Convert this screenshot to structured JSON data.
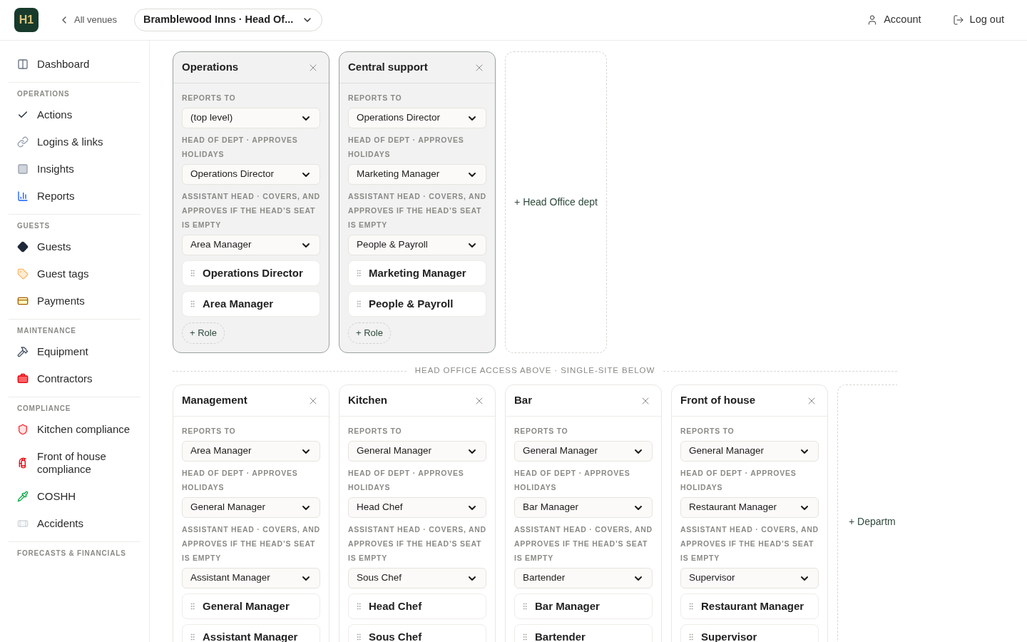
{
  "header": {
    "logo": "H1",
    "back_link": "All venues",
    "venue": "Bramblewood Inns · Head Of...",
    "account": "Account",
    "logout": "Log out"
  },
  "sidebar": {
    "top_items": [
      {
        "label": "Dashboard"
      }
    ],
    "sections": [
      {
        "title": "OPERATIONS",
        "items": [
          {
            "label": "Actions"
          },
          {
            "label": "Logins & links"
          },
          {
            "label": "Insights"
          },
          {
            "label": "Reports"
          }
        ]
      },
      {
        "title": "GUESTS",
        "items": [
          {
            "label": "Guests"
          },
          {
            "label": "Guest tags"
          },
          {
            "label": "Payments"
          }
        ]
      },
      {
        "title": "MAINTENANCE",
        "items": [
          {
            "label": "Equipment"
          },
          {
            "label": "Contractors"
          }
        ]
      },
      {
        "title": "COMPLIANCE",
        "items": [
          {
            "label": "Kitchen compliance"
          },
          {
            "label": "Front of house compliance"
          },
          {
            "label": "COSHH"
          },
          {
            "label": "Accidents"
          }
        ]
      },
      {
        "title": "FORECASTS & FINANCIALS"
      }
    ]
  },
  "sections": [
    {
      "kind": "head_office",
      "add_label": "+ Head Office dept",
      "departments": [
        {
          "name": "Operations",
          "reports_to_label": "REPORTS TO",
          "reports_to": "(top level)",
          "head_label": "HEAD OF DEPT · APPROVES HOLIDAYS",
          "head": "Operations Director",
          "assistant_label": "ASSISTANT HEAD · COVERS, AND APPROVES IF THE HEAD’S SEAT IS EMPTY",
          "assistant": "Area Manager",
          "roles": [
            "Operations Director",
            "Area Manager"
          ],
          "add_role": "+ Role"
        },
        {
          "name": "Central support",
          "reports_to_label": "REPORTS TO",
          "reports_to": "Operations Director",
          "head_label": "HEAD OF DEPT · APPROVES HOLIDAYS",
          "head": "Marketing Manager",
          "assistant_label": "ASSISTANT HEAD · COVERS, AND APPROVES IF THE HEAD’S SEAT IS EMPTY",
          "assistant": "People & Payroll",
          "roles": [
            "Marketing Manager",
            "People & Payroll"
          ],
          "add_role": "+ Role"
        }
      ]
    },
    {
      "kind": "site",
      "divider": "HEAD OFFICE ACCESS ABOVE · SINGLE-SITE BELOW",
      "add_label": "+ Departm",
      "departments": [
        {
          "name": "Management",
          "reports_to_label": "REPORTS TO",
          "reports_to": "Area Manager",
          "head_label": "HEAD OF DEPT · APPROVES HOLIDAYS",
          "head": "General Manager",
          "assistant_label": "ASSISTANT HEAD · COVERS, AND APPROVES IF THE HEAD’S SEAT IS EMPTY",
          "assistant": "Assistant Manager",
          "roles": [
            "General Manager",
            "Assistant Manager"
          ]
        },
        {
          "name": "Kitchen",
          "reports_to_label": "REPORTS TO",
          "reports_to": "General Manager",
          "head_label": "HEAD OF DEPT · APPROVES HOLIDAYS",
          "head": "Head Chef",
          "assistant_label": "ASSISTANT HEAD · COVERS, AND APPROVES IF THE HEAD’S SEAT IS EMPTY",
          "assistant": "Sous Chef",
          "roles": [
            "Head Chef",
            "Sous Chef"
          ]
        },
        {
          "name": "Bar",
          "reports_to_label": "REPORTS TO",
          "reports_to": "General Manager",
          "head_label": "HEAD OF DEPT · APPROVES HOLIDAYS",
          "head": "Bar Manager",
          "assistant_label": "ASSISTANT HEAD · COVERS, AND APPROVES IF THE HEAD’S SEAT IS EMPTY",
          "assistant": "Bartender",
          "roles": [
            "Bar Manager",
            "Bartender"
          ]
        },
        {
          "name": "Front of house",
          "reports_to_label": "REPORTS TO",
          "reports_to": "General Manager",
          "head_label": "HEAD OF DEPT · APPROVES HOLIDAYS",
          "head": "Restaurant Manager",
          "assistant_label": "ASSISTANT HEAD · COVERS, AND APPROVES IF THE HEAD’S SEAT IS EMPTY",
          "assistant": "Supervisor",
          "roles": [
            "Restaurant Manager",
            "Supervisor"
          ]
        }
      ]
    }
  ]
}
